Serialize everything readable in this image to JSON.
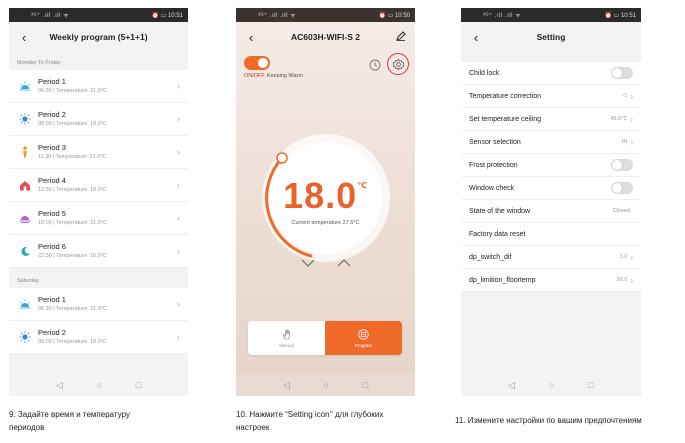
{
  "phone1": {
    "status": {
      "left": "³ᴳ⁺ .ıll .ıll ᯤ",
      "right": "⏰ ▭ 10:51"
    },
    "title": "Weekly program (5+1+1)",
    "section1": "Monday To Friday",
    "section2": "Saturday",
    "periods_weekday": [
      {
        "name": "Period 1",
        "detail": "06:30  |  Temperature: 21.0°C",
        "icon": "sunrise-icon",
        "color": "#3aa9c9"
      },
      {
        "name": "Period 2",
        "detail": "08:00  |  Temperature: 18.0°C",
        "icon": "sun-icon",
        "color": "#2f8ad8"
      },
      {
        "name": "Period 3",
        "detail": "11:30  |  Temperature: 21.0°C",
        "icon": "person-icon",
        "color": "#f0a020"
      },
      {
        "name": "Period 4",
        "detail": "12:30  |  Temperature: 18.0°C",
        "icon": "home-icon",
        "color": "#e05050"
      },
      {
        "name": "Period 5",
        "detail": "18:00  |  Temperature: 21.0°C",
        "icon": "sunset-icon",
        "color": "#c060c0"
      },
      {
        "name": "Period 6",
        "detail": "22:30  |  Temperature: 16.0°C",
        "icon": "moon-icon",
        "color": "#2aa8a8"
      }
    ],
    "periods_saturday": [
      {
        "name": "Period 1",
        "detail": "06:30  |  Temperature: 21.0°C",
        "icon": "sunrise-icon",
        "color": "#3aa9c9"
      },
      {
        "name": "Period 2",
        "detail": "08:00  |  Temperature: 18.0°C",
        "icon": "sun-icon",
        "color": "#2f8ad8"
      }
    ]
  },
  "phone2": {
    "status": {
      "left": "³ᴳ⁺ .ıll .ıll ᯤ",
      "right": "⏰ ▭ 10:50"
    },
    "title": "AC603H-WIFI-S 2",
    "onoff": "ON/OFF",
    "keeping": "Keeping Warm",
    "temperature": "18.0",
    "unit": "℃",
    "current": "Current temperature 27.5°C",
    "mode_manual": "Manual",
    "mode_program": "Program",
    "accent": "#f06a2a",
    "highlight": "#e03030"
  },
  "phone3": {
    "status": {
      "left": "³ᴳ⁺ .ıll .ıll ᯤ",
      "right": "⏰ ▭ 10:51"
    },
    "title": "Setting",
    "rows": [
      {
        "label": "Child lock",
        "value": "",
        "kind": "toggle"
      },
      {
        "label": "Temperature correction",
        "value": "-1",
        "kind": "value"
      },
      {
        "label": "Set temperature ceiling",
        "value": "45.0℃",
        "kind": "value"
      },
      {
        "label": "Sensor selection",
        "value": "IN",
        "kind": "value"
      },
      {
        "label": "Frost protection",
        "value": "",
        "kind": "toggle"
      },
      {
        "label": "Window check",
        "value": "",
        "kind": "toggle"
      },
      {
        "label": "State of the window",
        "value": "Closed",
        "kind": "text"
      },
      {
        "label": "Factory data reset",
        "value": "",
        "kind": "plain"
      },
      {
        "label": "dp_switch_dif",
        "value": "1.0",
        "kind": "value"
      },
      {
        "label": "dp_limition_floortemp",
        "value": "50.0",
        "kind": "value"
      }
    ]
  },
  "captions": {
    "c1_line1": "9. Задайте время и температуру",
    "c1_line2": "периодов",
    "c2_line1": "10. Нажмите “Setting icon’’ для  глубоких",
    "c2_line2": "настроек",
    "c3": "11. Измените настройки по вашим предпочтениям"
  }
}
